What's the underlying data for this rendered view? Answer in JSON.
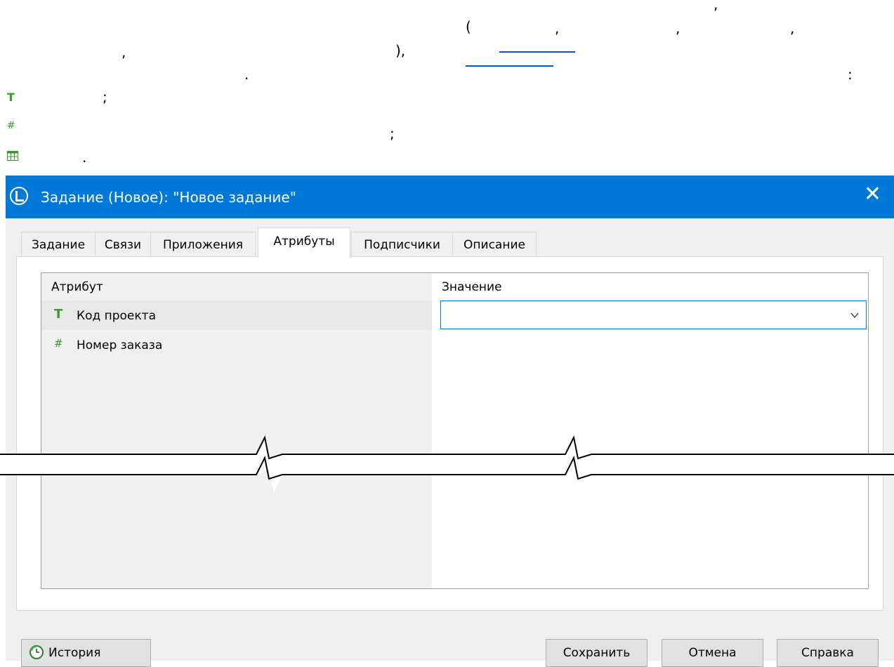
{
  "document": {
    "paren_open": "(",
    "comma": ",",
    "apostrophe": ",",
    "paren_close_comma": "),",
    "period": ".",
    "colon": ":",
    "semicolon": ";",
    "item_dot": ".",
    "icon_text_type": "T",
    "icon_number_type": "#",
    "icon_table_type": "table-icon"
  },
  "dialog": {
    "title": "Задание (Новое): \"Новое задание\"",
    "close_label": "✕",
    "tabs": [
      {
        "label": "Задание"
      },
      {
        "label": "Связи"
      },
      {
        "label": "Приложения"
      },
      {
        "label": "Атрибуты"
      },
      {
        "label": "Подписчики"
      },
      {
        "label": "Описание"
      }
    ],
    "grid": {
      "col_attribute": "Атрибут",
      "col_value": "Значение",
      "rows": [
        {
          "icon": "T",
          "label": "Код проекта",
          "value": ""
        },
        {
          "icon": "#",
          "label": "Номер заказа",
          "value": ""
        }
      ]
    },
    "buttons": {
      "history": "История",
      "save": "Сохранить",
      "cancel": "Отмена",
      "help": "Справка"
    }
  },
  "colors": {
    "titlebar": "#0078d7",
    "link": "#0b52c7",
    "icon_green": "#3a9a2c"
  }
}
